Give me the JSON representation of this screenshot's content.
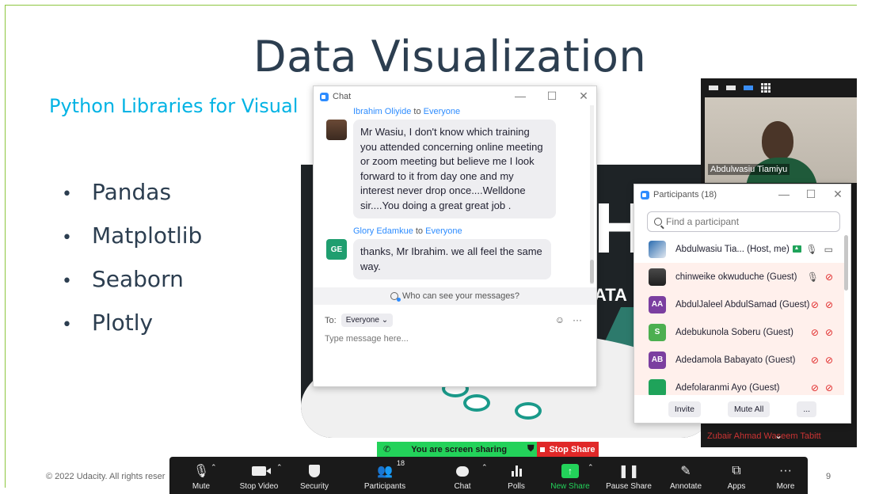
{
  "slide": {
    "title": "Data Visualization",
    "subtitle": "Python Libraries for Visual",
    "bullets": [
      "Pandas",
      "Matplotlib",
      "Seaborn",
      "Plotly"
    ],
    "bullet_symbol": "•",
    "copyright": "© 2022 Udacity.  All rights reser",
    "page_number": "9",
    "bg_letter": "H",
    "bg_text": "ATA"
  },
  "video": {
    "participant_name": "Abdulwasiu Tiamiyu",
    "second_name": "Zubair Ahmad Waseem Tabitt",
    "chevron": "⌄"
  },
  "chat": {
    "title": "Chat",
    "controls": [
      "—",
      "☐",
      "✕"
    ],
    "messages": [
      {
        "sender": "Ibrahim Oliyide",
        "to_word": "to",
        "recipient": "Everyone",
        "lines": [
          "Mr Wasiu, I don't know which training",
          "you attended concerning online meeting",
          "or zoom meeting but believe me I look",
          "forward to it from day one and my",
          "interest never drop once....Welldone",
          "sir....You doing a great great job ."
        ]
      },
      {
        "sender": "Glory Edamkue",
        "to_word": "to",
        "recipient": "Everyone",
        "avatar_initials": "GE",
        "lines": [
          "thanks, Mr Ibrahim. we all feel the same",
          "way."
        ]
      }
    ],
    "who_can_see": "Who can see your messages?",
    "to_label": "To:",
    "to_value": "Everyone",
    "emoji": "☺",
    "more": "···",
    "input_placeholder": "Type message here..."
  },
  "participants": {
    "title": "Participants (18)",
    "controls": [
      "—",
      "☐",
      "✕"
    ],
    "search_placeholder": "Find a participant",
    "rows": [
      {
        "initials": "",
        "name": "Abdulwasiu Tia...  (Host, me)",
        "avatar": "photo1"
      },
      {
        "initials": "",
        "name": "chinweike okwuduche (Guest)",
        "avatar": "photo2"
      },
      {
        "initials": "AA",
        "name": "AbdulJaleel AbdulSamad (Guest)",
        "avatar": "purple"
      },
      {
        "initials": "S",
        "name": "Adebukunola Soberu (Guest)",
        "avatar": "green"
      },
      {
        "initials": "AB",
        "name": "Adedamola Babayato (Guest)",
        "avatar": "purple"
      },
      {
        "initials": "",
        "name": "Adefolaranmi Ayo (Guest)",
        "avatar": "green2"
      }
    ],
    "buttons": [
      "Invite",
      "Mute All",
      "..."
    ]
  },
  "share_banner": {
    "status": "You are screen sharing",
    "stop": "Stop Share"
  },
  "toolbar": {
    "items": [
      {
        "label": "Mute",
        "icon": "microphone-icon"
      },
      {
        "label": "Stop Video",
        "icon": "video-icon"
      },
      {
        "label": "Security",
        "icon": "shield-icon"
      },
      {
        "label": "Participants",
        "icon": "participants-icon",
        "count": "18"
      },
      {
        "label": "Chat",
        "icon": "chat-icon"
      },
      {
        "label": "Polls",
        "icon": "polls-icon"
      },
      {
        "label": "New Share",
        "icon": "share-icon"
      },
      {
        "label": "Pause Share",
        "icon": "pause-icon"
      },
      {
        "label": "Annotate",
        "icon": "pen-icon"
      },
      {
        "label": "Apps",
        "icon": "apps-icon"
      },
      {
        "label": "More",
        "icon": "more-icon"
      }
    ],
    "colors": {
      "bar": "#1a1a1a",
      "share": "#23d25a",
      "stop": "#e02828"
    }
  }
}
